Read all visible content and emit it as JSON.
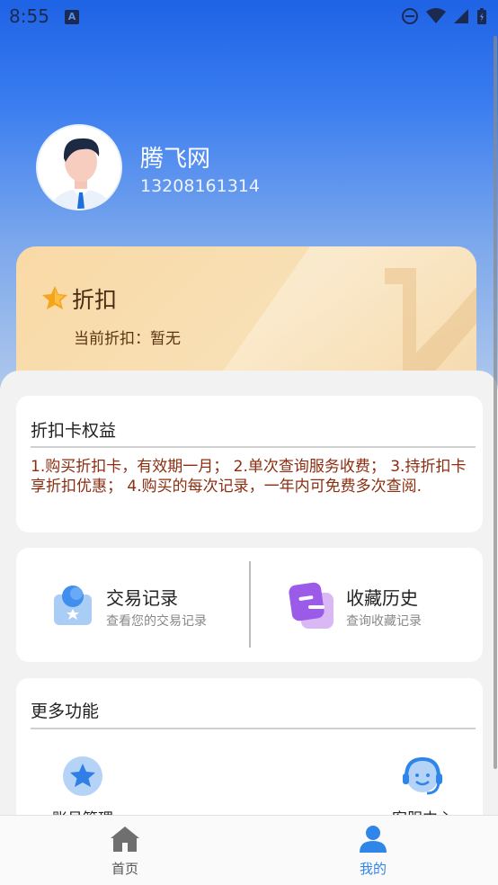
{
  "status_bar": {
    "time": "8:55",
    "notif_letter": "A"
  },
  "profile": {
    "name": "腾飞网",
    "phone": "13208161314"
  },
  "discount": {
    "title": "折扣",
    "current": "当前折扣：暂无"
  },
  "benefits": {
    "title": "折扣卡权益",
    "text": "1.购买折扣卡，有效期一月； 2.单次查询服务收费； 3.持折扣卡享折扣优惠； 4.购买的每次记录，一年内可免费多次查阅."
  },
  "records": {
    "trade": {
      "label": "交易记录",
      "sub": "查看您的交易记录"
    },
    "favorites": {
      "label": "收藏历史",
      "sub": "查询收藏记录"
    }
  },
  "more": {
    "title": "更多功能",
    "account": "账号管理",
    "service": "客服中心"
  },
  "tabs": {
    "home": "首页",
    "mine": "我的"
  },
  "colors": {
    "accent": "#2f86e8",
    "benefit_text": "#8b2d10",
    "card_gold": "#f8dcae"
  }
}
